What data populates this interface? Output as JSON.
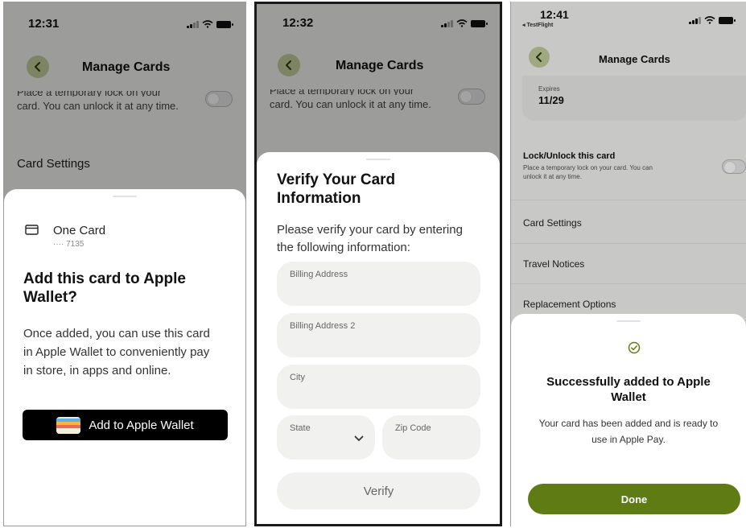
{
  "screen1": {
    "time": "12:31",
    "nav_title": "Manage Cards",
    "bg_lock_text_1": "Place a temporary lock on your",
    "bg_lock_text_2": "card. You can unlock it at any time.",
    "bg_card_settings": "Card Settings",
    "sheet": {
      "card_name": "One Card",
      "card_number": "···· 7135",
      "title_line1": "Add this card to Apple",
      "title_line2": "Wallet?",
      "body_line1": "Once added, you can use this card",
      "body_line2": "in Apple Wallet to conveniently pay",
      "body_line3": "in store, in apps and online.",
      "wallet_button": "Add to Apple Wallet"
    }
  },
  "screen2": {
    "time": "12:32",
    "nav_title": "Manage Cards",
    "bg_lock_text_1": "Place a temporary lock on your",
    "bg_lock_text_2": "card. You can unlock it at any time.",
    "sheet": {
      "title_line1": "Verify Your Card",
      "title_line2": "Information",
      "body_line1": "Please verify your card by entering",
      "body_line2": "the following information:",
      "billing_address_label": "Billing Address",
      "billing_address2_label": "Billing Address 2",
      "city_label": "City",
      "state_label": "State",
      "zip_label": "Zip Code",
      "verify_button": "Verify"
    }
  },
  "screen3": {
    "time": "12:41",
    "back_app": "◂ TestFlight",
    "nav_title": "Manage Cards",
    "expires_label": "Expires",
    "expires_value": "11/29",
    "lock_title": "Lock/Unlock this card",
    "lock_desc_1": "Place a temporary lock on your card. You can",
    "lock_desc_2": "unlock it at any time.",
    "menu": [
      "Card Settings",
      "Travel Notices",
      "Replacement Options"
    ],
    "sheet": {
      "title_line1": "Successfully added to Apple",
      "title_line2": "Wallet",
      "body_line1": "Your card has been added and is ready to",
      "body_line2": "use in Apple Pay.",
      "done_button": "Done"
    }
  },
  "colors": {
    "accent_green": "#5f7c14",
    "back_button_green": "#c3cf9b",
    "sheet_bg": "#ffffff",
    "field_bg": "#f1f1f0"
  }
}
